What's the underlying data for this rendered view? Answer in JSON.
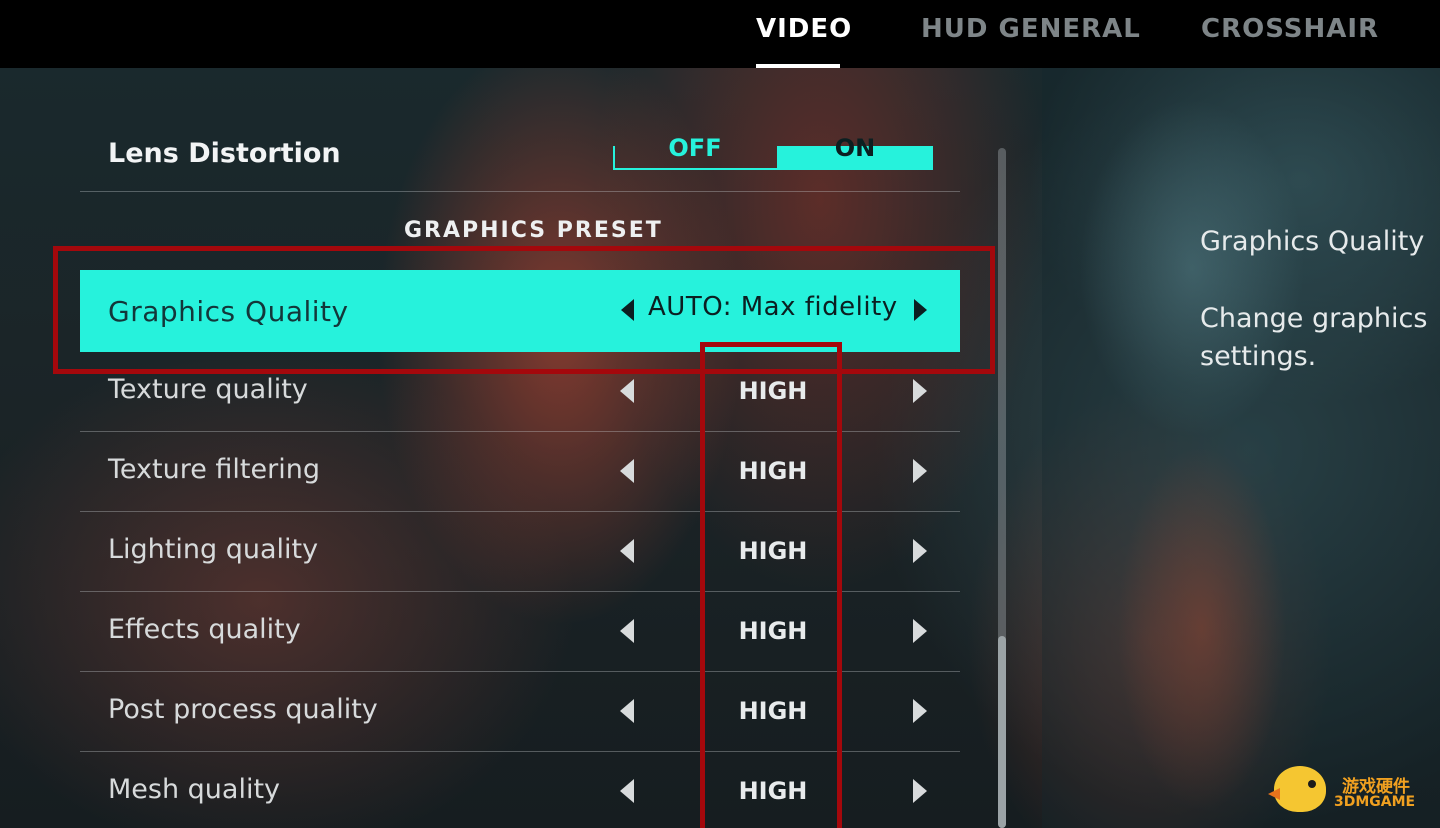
{
  "tabs": [
    {
      "label": "VIDEO",
      "active": true
    },
    {
      "label": "HUD GENERAL",
      "active": false
    },
    {
      "label": "CROSSHAIR",
      "active": false
    }
  ],
  "lens_distortion": {
    "label": "Lens Distortion",
    "off_label": "OFF",
    "on_label": "ON",
    "selected": "ON"
  },
  "section_heading": "GRAPHICS PRESET",
  "graphics_quality": {
    "label": "Graphics Quality",
    "value": "AUTO: Max fidelity"
  },
  "settings": [
    {
      "label": "Texture quality",
      "value": "HIGH"
    },
    {
      "label": "Texture filtering",
      "value": "HIGH"
    },
    {
      "label": "Lighting quality",
      "value": "HIGH"
    },
    {
      "label": "Effects quality",
      "value": "HIGH"
    },
    {
      "label": "Post process quality",
      "value": "HIGH"
    },
    {
      "label": "Mesh quality",
      "value": "HIGH"
    }
  ],
  "description": {
    "title": "Graphics Quality",
    "body": "Change graphics settings."
  },
  "watermark": {
    "line1": "游戏硬件",
    "line2": "3DMGAME"
  },
  "colors": {
    "accent": "#26f2dc",
    "highlight_box": "#a4080c"
  }
}
